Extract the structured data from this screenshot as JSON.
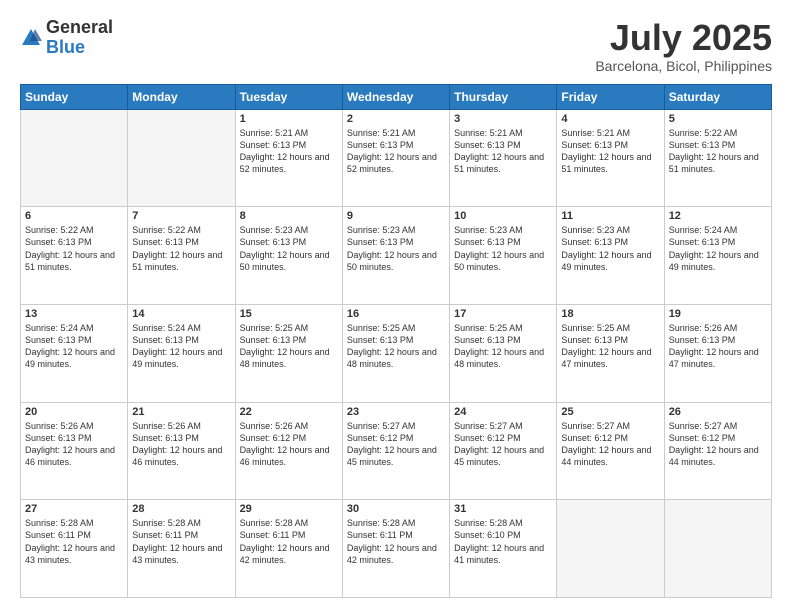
{
  "logo": {
    "general": "General",
    "blue": "Blue"
  },
  "title": {
    "month_year": "July 2025",
    "location": "Barcelona, Bicol, Philippines"
  },
  "days_of_week": [
    "Sunday",
    "Monday",
    "Tuesday",
    "Wednesday",
    "Thursday",
    "Friday",
    "Saturday"
  ],
  "weeks": [
    [
      {
        "day": "",
        "info": ""
      },
      {
        "day": "",
        "info": ""
      },
      {
        "day": "1",
        "info": "Sunrise: 5:21 AM\nSunset: 6:13 PM\nDaylight: 12 hours and 52 minutes."
      },
      {
        "day": "2",
        "info": "Sunrise: 5:21 AM\nSunset: 6:13 PM\nDaylight: 12 hours and 52 minutes."
      },
      {
        "day": "3",
        "info": "Sunrise: 5:21 AM\nSunset: 6:13 PM\nDaylight: 12 hours and 51 minutes."
      },
      {
        "day": "4",
        "info": "Sunrise: 5:21 AM\nSunset: 6:13 PM\nDaylight: 12 hours and 51 minutes."
      },
      {
        "day": "5",
        "info": "Sunrise: 5:22 AM\nSunset: 6:13 PM\nDaylight: 12 hours and 51 minutes."
      }
    ],
    [
      {
        "day": "6",
        "info": "Sunrise: 5:22 AM\nSunset: 6:13 PM\nDaylight: 12 hours and 51 minutes."
      },
      {
        "day": "7",
        "info": "Sunrise: 5:22 AM\nSunset: 6:13 PM\nDaylight: 12 hours and 51 minutes."
      },
      {
        "day": "8",
        "info": "Sunrise: 5:23 AM\nSunset: 6:13 PM\nDaylight: 12 hours and 50 minutes."
      },
      {
        "day": "9",
        "info": "Sunrise: 5:23 AM\nSunset: 6:13 PM\nDaylight: 12 hours and 50 minutes."
      },
      {
        "day": "10",
        "info": "Sunrise: 5:23 AM\nSunset: 6:13 PM\nDaylight: 12 hours and 50 minutes."
      },
      {
        "day": "11",
        "info": "Sunrise: 5:23 AM\nSunset: 6:13 PM\nDaylight: 12 hours and 49 minutes."
      },
      {
        "day": "12",
        "info": "Sunrise: 5:24 AM\nSunset: 6:13 PM\nDaylight: 12 hours and 49 minutes."
      }
    ],
    [
      {
        "day": "13",
        "info": "Sunrise: 5:24 AM\nSunset: 6:13 PM\nDaylight: 12 hours and 49 minutes."
      },
      {
        "day": "14",
        "info": "Sunrise: 5:24 AM\nSunset: 6:13 PM\nDaylight: 12 hours and 49 minutes."
      },
      {
        "day": "15",
        "info": "Sunrise: 5:25 AM\nSunset: 6:13 PM\nDaylight: 12 hours and 48 minutes."
      },
      {
        "day": "16",
        "info": "Sunrise: 5:25 AM\nSunset: 6:13 PM\nDaylight: 12 hours and 48 minutes."
      },
      {
        "day": "17",
        "info": "Sunrise: 5:25 AM\nSunset: 6:13 PM\nDaylight: 12 hours and 48 minutes."
      },
      {
        "day": "18",
        "info": "Sunrise: 5:25 AM\nSunset: 6:13 PM\nDaylight: 12 hours and 47 minutes."
      },
      {
        "day": "19",
        "info": "Sunrise: 5:26 AM\nSunset: 6:13 PM\nDaylight: 12 hours and 47 minutes."
      }
    ],
    [
      {
        "day": "20",
        "info": "Sunrise: 5:26 AM\nSunset: 6:13 PM\nDaylight: 12 hours and 46 minutes."
      },
      {
        "day": "21",
        "info": "Sunrise: 5:26 AM\nSunset: 6:13 PM\nDaylight: 12 hours and 46 minutes."
      },
      {
        "day": "22",
        "info": "Sunrise: 5:26 AM\nSunset: 6:12 PM\nDaylight: 12 hours and 46 minutes."
      },
      {
        "day": "23",
        "info": "Sunrise: 5:27 AM\nSunset: 6:12 PM\nDaylight: 12 hours and 45 minutes."
      },
      {
        "day": "24",
        "info": "Sunrise: 5:27 AM\nSunset: 6:12 PM\nDaylight: 12 hours and 45 minutes."
      },
      {
        "day": "25",
        "info": "Sunrise: 5:27 AM\nSunset: 6:12 PM\nDaylight: 12 hours and 44 minutes."
      },
      {
        "day": "26",
        "info": "Sunrise: 5:27 AM\nSunset: 6:12 PM\nDaylight: 12 hours and 44 minutes."
      }
    ],
    [
      {
        "day": "27",
        "info": "Sunrise: 5:28 AM\nSunset: 6:11 PM\nDaylight: 12 hours and 43 minutes."
      },
      {
        "day": "28",
        "info": "Sunrise: 5:28 AM\nSunset: 6:11 PM\nDaylight: 12 hours and 43 minutes."
      },
      {
        "day": "29",
        "info": "Sunrise: 5:28 AM\nSunset: 6:11 PM\nDaylight: 12 hours and 42 minutes."
      },
      {
        "day": "30",
        "info": "Sunrise: 5:28 AM\nSunset: 6:11 PM\nDaylight: 12 hours and 42 minutes."
      },
      {
        "day": "31",
        "info": "Sunrise: 5:28 AM\nSunset: 6:10 PM\nDaylight: 12 hours and 41 minutes."
      },
      {
        "day": "",
        "info": ""
      },
      {
        "day": "",
        "info": ""
      }
    ]
  ]
}
